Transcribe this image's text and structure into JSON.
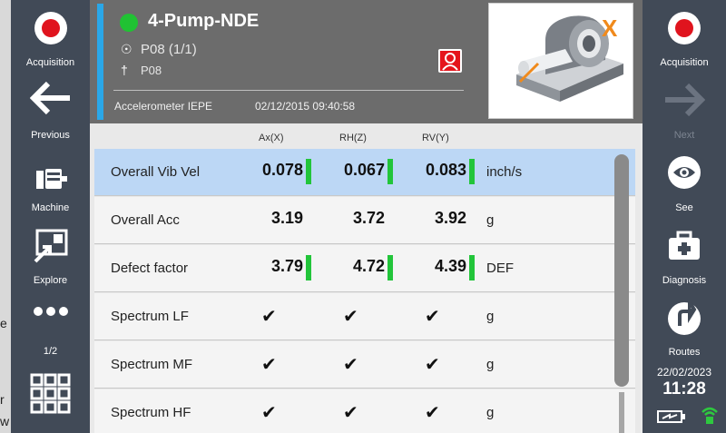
{
  "left_panel": {
    "acquisition_label": "Acquisition",
    "previous_label": "Previous",
    "machine_label": "Machine",
    "explore_label": "Explore",
    "page_indicator": "1/2"
  },
  "right_panel": {
    "acquisition_label": "Acquisition",
    "next_label": "Next",
    "see_label": "See",
    "diagnosis_label": "Diagnosis",
    "routes_label": "Routes",
    "date": "22/02/2023",
    "time": "11:28"
  },
  "header": {
    "title": "4-Pump-NDE",
    "point": "P08 (1/1)",
    "point_id": "P08",
    "sensor": "Accelerometer IEPE",
    "datetime": "02/12/2015 09:40:58",
    "thumbnail_marker": "X"
  },
  "columns": [
    "Ax(X)",
    "RH(Z)",
    "RV(Y)"
  ],
  "measurements": [
    {
      "name": "Overall Vib Vel",
      "values": [
        "0.078",
        "0.067",
        "0.083"
      ],
      "unit": "inch/s",
      "bars": [
        true,
        true,
        true
      ],
      "selected": true
    },
    {
      "name": "Overall Acc",
      "values": [
        "3.19",
        "3.72",
        "3.92"
      ],
      "unit": "g",
      "bars": [
        false,
        false,
        false
      ],
      "selected": false
    },
    {
      "name": "Defect factor",
      "values": [
        "3.79",
        "4.72",
        "4.39"
      ],
      "unit": "DEF",
      "bars": [
        true,
        true,
        true
      ],
      "selected": false
    },
    {
      "name": "Spectrum LF",
      "checks": [
        "✔",
        "✔",
        "✔"
      ],
      "unit": "g"
    },
    {
      "name": "Spectrum MF",
      "checks": [
        "✔",
        "✔",
        "✔"
      ],
      "unit": "g"
    },
    {
      "name": "Spectrum HF",
      "checks": [
        "✔",
        "✔",
        "✔"
      ],
      "unit": "g"
    }
  ],
  "colors": {
    "status_ok": "#20c233",
    "bar_ok": "#22c53a",
    "record": "#e0141e",
    "accent": "#2aa7e8",
    "selected_row": "#bcd7f5"
  }
}
